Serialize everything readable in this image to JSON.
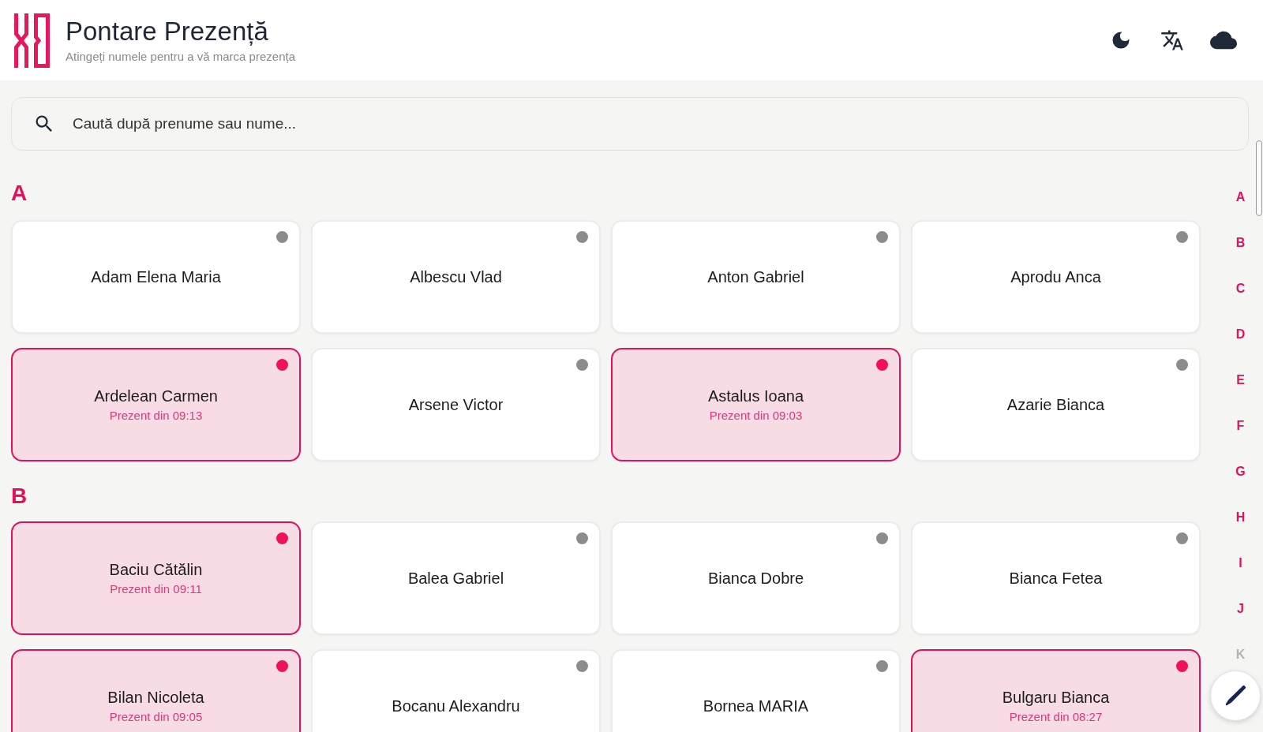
{
  "header": {
    "title": "Pontare Prezență",
    "subtitle": "Atingeți numele pentru a vă marca prezența"
  },
  "search": {
    "placeholder": "Caută după prenume sau nume..."
  },
  "sections": [
    {
      "letter": "A",
      "people": [
        {
          "name": "Adam Elena Maria",
          "present": false
        },
        {
          "name": "Albescu Vlad",
          "present": false
        },
        {
          "name": "Anton Gabriel",
          "present": false
        },
        {
          "name": "Aprodu Anca",
          "present": false
        },
        {
          "name": "Ardelean Carmen",
          "present": true,
          "status": "Prezent din 09:13"
        },
        {
          "name": "Arsene Victor",
          "present": false
        },
        {
          "name": "Astalus Ioana",
          "present": true,
          "status": "Prezent din 09:03"
        },
        {
          "name": "Azarie Bianca",
          "present": false
        }
      ]
    },
    {
      "letter": "B",
      "people": [
        {
          "name": "Baciu Cătălin",
          "present": true,
          "status": "Prezent din 09:11"
        },
        {
          "name": "Balea Gabriel",
          "present": false
        },
        {
          "name": "Bianca Dobre",
          "present": false
        },
        {
          "name": "Bianca Fetea",
          "present": false
        },
        {
          "name": "Bilan Nicoleta",
          "present": true,
          "status": "Prezent din 09:05"
        },
        {
          "name": "Bocanu Alexandru",
          "present": false
        },
        {
          "name": "Bornea MARIA",
          "present": false
        },
        {
          "name": "Bulgaru Bianca",
          "present": true,
          "status": "Prezent din 08:27"
        }
      ]
    }
  ],
  "alphabet_index": [
    {
      "letter": "A",
      "disabled": false
    },
    {
      "letter": "B",
      "disabled": false
    },
    {
      "letter": "C",
      "disabled": false
    },
    {
      "letter": "D",
      "disabled": false
    },
    {
      "letter": "E",
      "disabled": false
    },
    {
      "letter": "F",
      "disabled": false
    },
    {
      "letter": "G",
      "disabled": false
    },
    {
      "letter": "H",
      "disabled": false
    },
    {
      "letter": "I",
      "disabled": false
    },
    {
      "letter": "J",
      "disabled": false
    },
    {
      "letter": "K",
      "disabled": true
    }
  ]
}
